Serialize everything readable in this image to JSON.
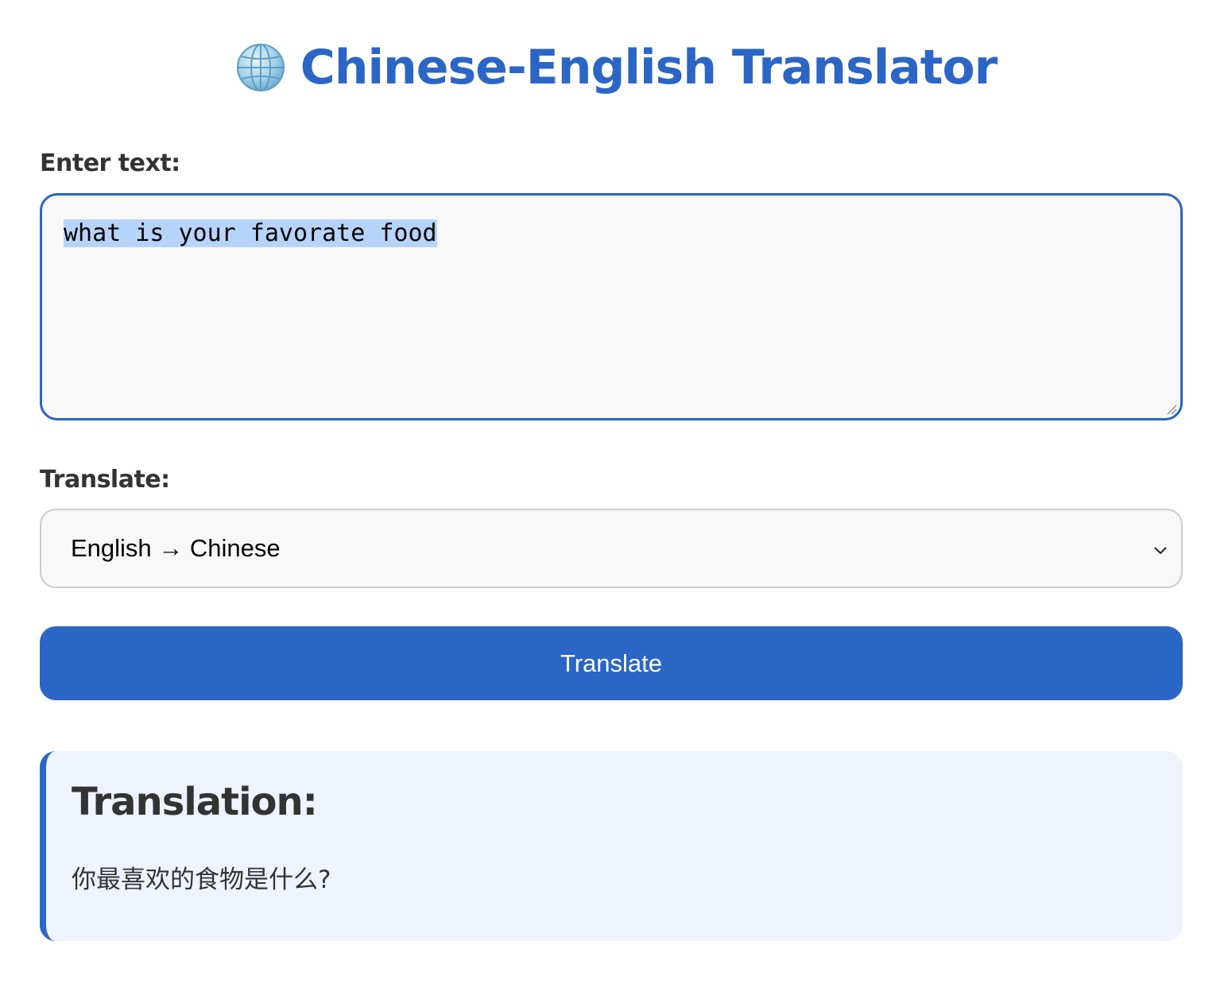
{
  "app": {
    "title": "Chinese-English Translator",
    "icon": "globe-icon"
  },
  "input_section": {
    "label": "Enter text:",
    "value": "what is your favorate food"
  },
  "direction_section": {
    "label": "Translate:",
    "selected": "English → Chinese"
  },
  "actions": {
    "translate_label": "Translate"
  },
  "result": {
    "heading": "Translation:",
    "text": "你最喜欢的食物是什么?"
  },
  "colors": {
    "accent": "#2b65c6",
    "selection": "#b6d4fb",
    "result_background": "#eff3fe",
    "field_background": "#f8f8f8"
  }
}
